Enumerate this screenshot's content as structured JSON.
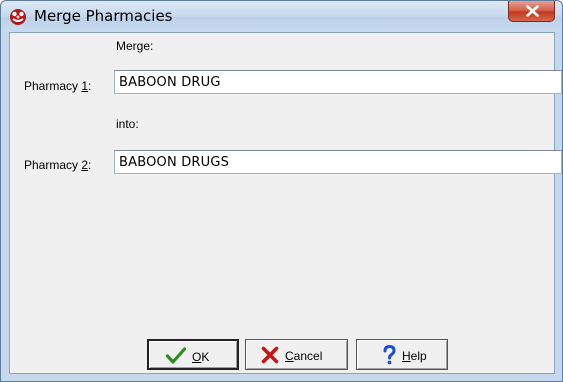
{
  "window": {
    "title": "Merge Pharmacies",
    "app_icon": "pharmacy-logo-icon",
    "close_icon": "close-icon"
  },
  "form": {
    "merge_label": "Merge:",
    "pharmacy1_label_pre": "Pharmacy ",
    "pharmacy1_label_key": "1",
    "pharmacy1_label_post": ":",
    "pharmacy1_value": "BABOON DRUG",
    "into_label": "into:",
    "pharmacy2_label_pre": "Pharmacy ",
    "pharmacy2_label_key": "2",
    "pharmacy2_label_post": ":",
    "pharmacy2_value": "BABOON DRUGS"
  },
  "buttons": {
    "ok_key": "O",
    "ok_rest": "K",
    "ok_icon": "checkmark-icon",
    "cancel_key": "C",
    "cancel_rest": "ancel",
    "cancel_icon": "x-cancel-icon",
    "help_key": "H",
    "help_rest": "elp",
    "help_icon": "question-mark-icon"
  },
  "colors": {
    "ok_icon": "#2e8b1e",
    "cancel_icon": "#c81414",
    "help_icon": "#1b4fd1"
  }
}
